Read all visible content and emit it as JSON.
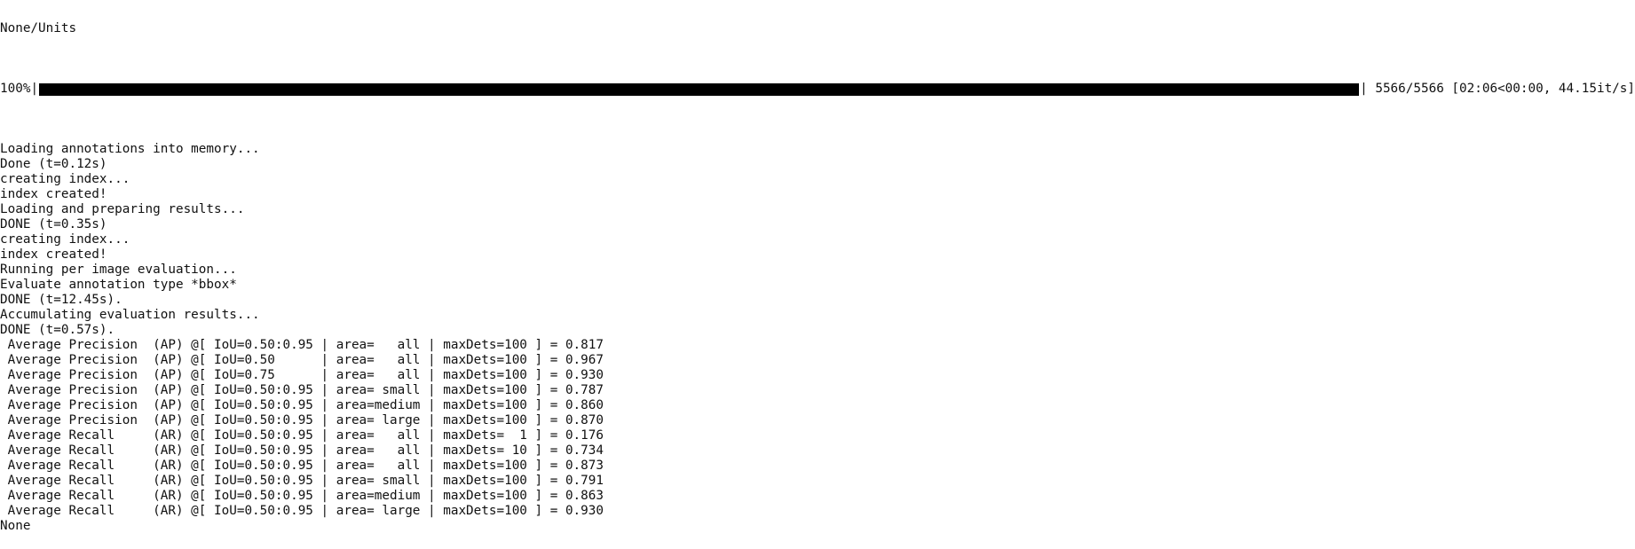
{
  "window": {
    "type": "terminal output"
  },
  "terminal": {
    "top_partial": "None/Units",
    "progress": {
      "percent_label": "100%",
      "fraction": 1.0,
      "left_pipe": "|",
      "right_pipe": "|",
      "status": " 5566/5566 [02:06<00:00, 44.15it/s]"
    },
    "lines": [
      "Loading annotations into memory...",
      "Done (t=0.12s)",
      "creating index...",
      "index created!",
      "Loading and preparing results...",
      "DONE (t=0.35s)",
      "creating index...",
      "index created!",
      "Running per image evaluation...",
      "Evaluate annotation type *bbox*",
      "DONE (t=12.45s).",
      "Accumulating evaluation results...",
      "DONE (t=0.57s).",
      " Average Precision  (AP) @[ IoU=0.50:0.95 | area=   all | maxDets=100 ] = 0.817",
      " Average Precision  (AP) @[ IoU=0.50      | area=   all | maxDets=100 ] = 0.967",
      " Average Precision  (AP) @[ IoU=0.75      | area=   all | maxDets=100 ] = 0.930",
      " Average Precision  (AP) @[ IoU=0.50:0.95 | area= small | maxDets=100 ] = 0.787",
      " Average Precision  (AP) @[ IoU=0.50:0.95 | area=medium | maxDets=100 ] = 0.860",
      " Average Precision  (AP) @[ IoU=0.50:0.95 | area= large | maxDets=100 ] = 0.870",
      " Average Recall     (AR) @[ IoU=0.50:0.95 | area=   all | maxDets=  1 ] = 0.176",
      " Average Recall     (AR) @[ IoU=0.50:0.95 | area=   all | maxDets= 10 ] = 0.734",
      " Average Recall     (AR) @[ IoU=0.50:0.95 | area=   all | maxDets=100 ] = 0.873",
      " Average Recall     (AR) @[ IoU=0.50:0.95 | area= small | maxDets=100 ] = 0.791",
      " Average Recall     (AR) @[ IoU=0.50:0.95 | area=medium | maxDets=100 ] = 0.863",
      " Average Recall     (AR) @[ IoU=0.50:0.95 | area= large | maxDets=100 ] = 0.930",
      "None"
    ]
  }
}
